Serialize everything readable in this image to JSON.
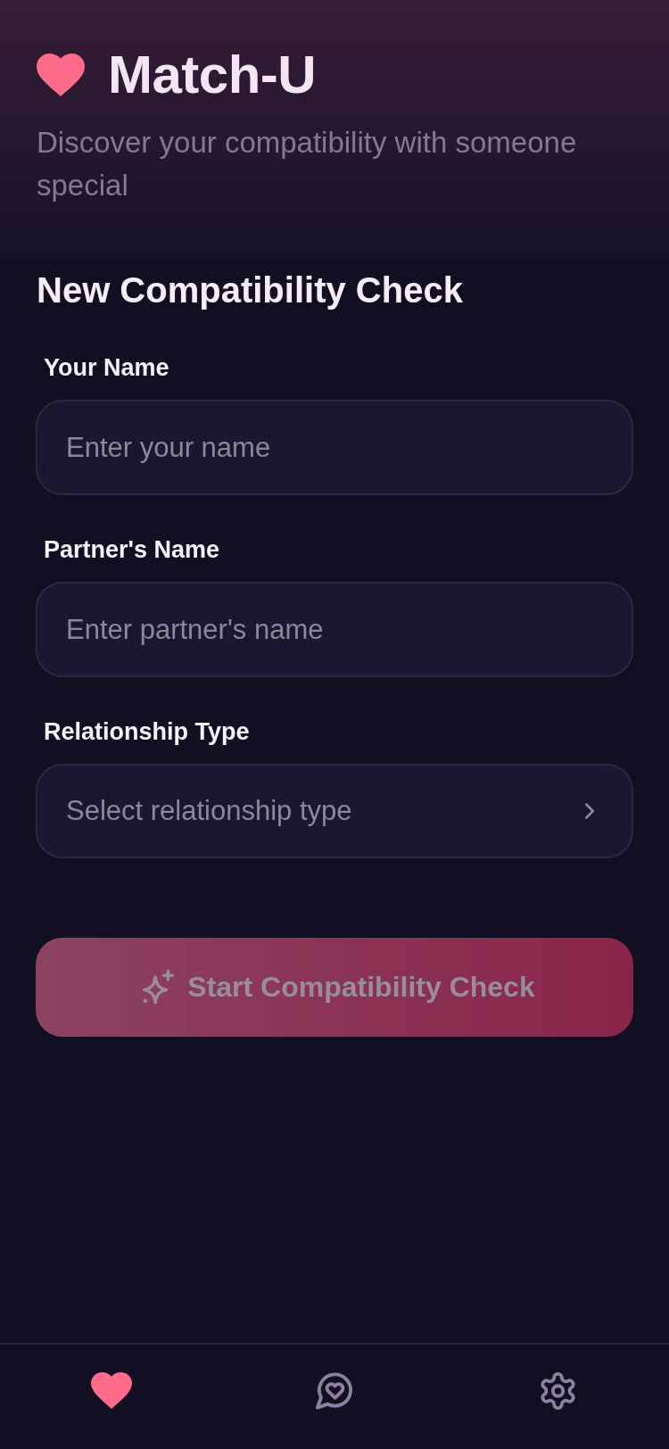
{
  "app": {
    "title": "Match-U",
    "subtitle": "Discover your compatibility with someone special"
  },
  "form": {
    "title": "New Compatibility Check",
    "fields": [
      {
        "kind": "text",
        "label": "Your Name",
        "placeholder": "Enter your name"
      },
      {
        "kind": "text",
        "label": "Partner's Name",
        "placeholder": "Enter partner's name"
      },
      {
        "kind": "select",
        "label": "Relationship Type",
        "placeholder": "Select relationship type"
      }
    ],
    "submit_button": {
      "label": "Start Compatibility Check",
      "disabled": true
    }
  },
  "tab_bar": {
    "tabs": [
      {
        "selected": true
      },
      {
        "selected": false
      },
      {
        "selected": false
      }
    ]
  }
}
